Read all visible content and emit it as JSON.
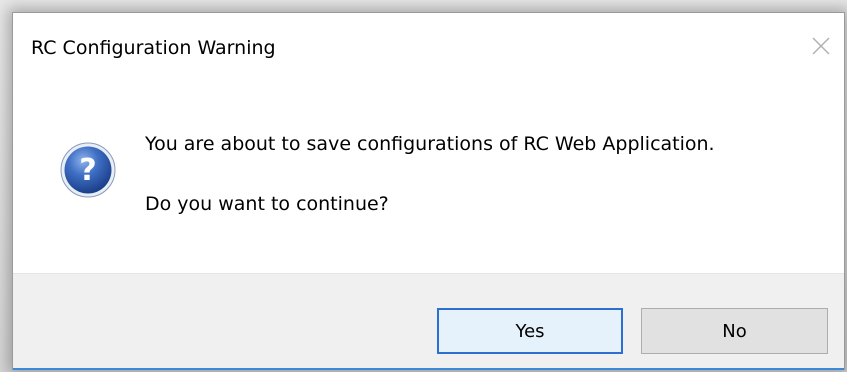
{
  "dialog": {
    "title": "RC Configuration Warning",
    "message_line1": "You are about to save configurations of RC Web Application.",
    "message_line2": "Do you want to continue?",
    "icon": "question-icon",
    "buttons": {
      "yes_label": "Yes",
      "no_label": "No"
    },
    "close_icon": "close-icon"
  },
  "colors": {
    "button_bar": "#f0f0f0",
    "default_button_border": "#2c6fd1",
    "icon_blue": "#2f5fb0"
  }
}
